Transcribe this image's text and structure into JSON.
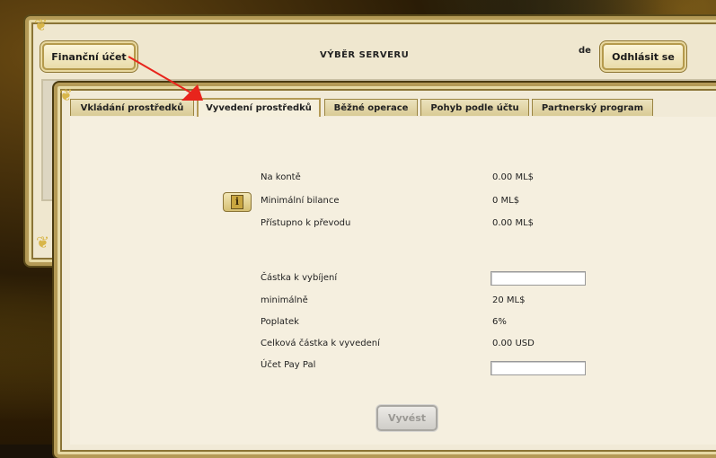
{
  "header": {
    "account_button": "Finanční účet",
    "title": "VÝBĚR SERVERU",
    "language": "de",
    "logout_button": "Odhlásit se"
  },
  "tabs": [
    {
      "label": "Vkládání prostředků",
      "active": false
    },
    {
      "label": "Vyvedení prostředků",
      "active": true
    },
    {
      "label": "Běžné operace",
      "active": false
    },
    {
      "label": "Pohyb podle účtu",
      "active": false
    },
    {
      "label": "Partnerský program",
      "active": false
    }
  ],
  "balance": {
    "on_account_label": "Na kontě",
    "on_account_value": "0.00 ML$",
    "min_balance_label": "Minimální bilance",
    "min_balance_value": "0 ML$",
    "available_label": "Přístupno k převodu",
    "available_value": "0.00 ML$"
  },
  "withdraw": {
    "amount_label": "Částka k vybíjení",
    "amount_value": "",
    "minimum_label": "minimálně",
    "minimum_value": "20 ML$",
    "fee_label": "Poplatek",
    "fee_value": "6%",
    "total_label": "Celková částka k vyvedení",
    "total_value": "0.00 USD",
    "paypal_label": "Účet Pay Pal",
    "paypal_value": "",
    "submit_button": "Vyvést"
  },
  "icons": {
    "info": "info-icon"
  },
  "colors": {
    "panel": "#f1ead7",
    "frame_gold": "#b49a56",
    "arrow": "#e8241c"
  }
}
